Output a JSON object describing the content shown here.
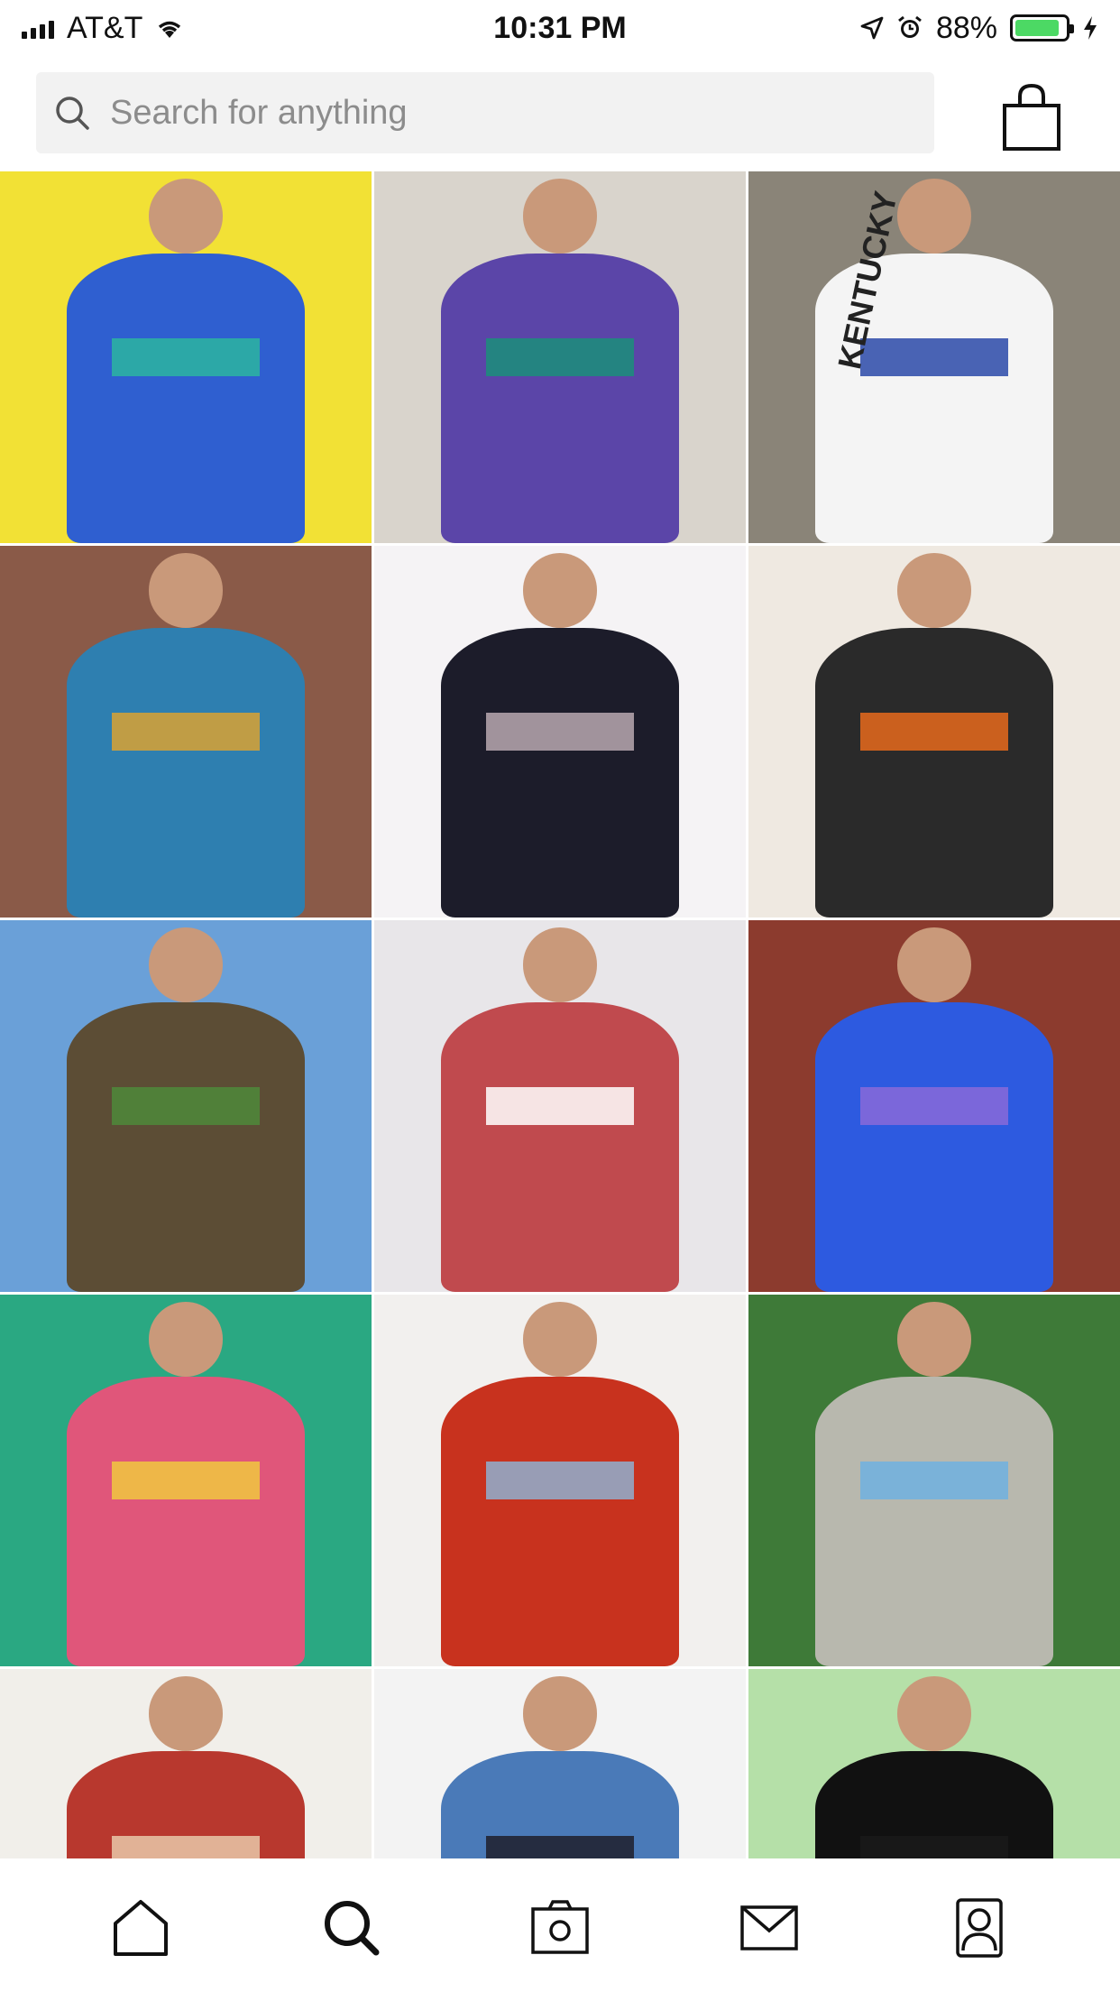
{
  "status_bar": {
    "carrier": "AT&T",
    "time": "10:31 PM",
    "battery": "88%",
    "battery_level": 0.88
  },
  "search": {
    "placeholder": "Search for anything",
    "icon": "search-icon"
  },
  "header": {
    "cart_icon": "shopping-bag-icon"
  },
  "products": [
    {
      "name": "product-blue-windbreaker",
      "colors": {
        "bg": "#f2e135",
        "item": "#2f5fd0",
        "accent": "#2bb5a0"
      }
    },
    {
      "name": "product-purple-teal-jacket",
      "colors": {
        "bg": "#d9d4cc",
        "item": "#5b45a8",
        "accent": "#1b8f7a"
      }
    },
    {
      "name": "product-kentucky-mickey-sweatshirt",
      "colors": {
        "bg": "#8a8478",
        "item": "#f4f4f4",
        "accent": "#2a49a8"
      },
      "text": "KENTUCKY"
    },
    {
      "name": "product-patterned-windbreaker",
      "colors": {
        "bg": "#8a5a48",
        "item": "#2e7fb0",
        "accent": "#d9a233"
      }
    },
    {
      "name": "product-leather-bucket-bag",
      "colors": {
        "bg": "#f5f3f5",
        "item": "#1c1c2a",
        "accent": "#b9a8b0"
      }
    },
    {
      "name": "product-patterned-knit-sweater",
      "colors": {
        "bg": "#efe9e1",
        "item": "#2a2a2a",
        "accent": "#e86a1c"
      }
    },
    {
      "name": "product-snakeskin-jacket",
      "colors": {
        "bg": "#6aa0d8",
        "item": "#5c4d35",
        "accent": "#4d8a3a"
      }
    },
    {
      "name": "product-striped-red-shirt",
      "colors": {
        "bg": "#e8e6e9",
        "item": "#c04a4e",
        "accent": "#ffffff"
      }
    },
    {
      "name": "product-blue-purple-tee",
      "colors": {
        "bg": "#8c3b2e",
        "item": "#2d5ae0",
        "accent": "#8a6ad8"
      }
    },
    {
      "name": "product-rainbow-organza-shawl",
      "colors": {
        "bg": "#2aa882",
        "item": "#e0567a",
        "accent": "#f0c840"
      }
    },
    {
      "name": "product-red-snakeskin-wrap-top",
      "colors": {
        "bg": "#f2f0ee",
        "item": "#c8321e",
        "accent": "#8fb0d0"
      }
    },
    {
      "name": "product-snakeskin-pants",
      "colors": {
        "bg": "#3e7a38",
        "item": "#b8b8ae",
        "accent": "#6fb0e0"
      }
    },
    {
      "name": "product-red-floral-peasant-top",
      "colors": {
        "bg": "#f1efea",
        "item": "#b8382e",
        "accent": "#e8c8a8"
      }
    },
    {
      "name": "product-blue-silk-blouse",
      "colors": {
        "bg": "#f3f3f3",
        "item": "#4a7ab8",
        "accent": "#1f1f2a"
      }
    },
    {
      "name": "product-black-graphic-tee",
      "colors": {
        "bg": "#b5e0a8",
        "item": "#111111",
        "accent": "#1a1a1a"
      }
    }
  ],
  "bottom_nav": [
    {
      "name": "nav-home",
      "icon": "home-icon"
    },
    {
      "name": "nav-search",
      "icon": "search-icon"
    },
    {
      "name": "nav-camera",
      "icon": "camera-icon"
    },
    {
      "name": "nav-messages",
      "icon": "mail-icon"
    },
    {
      "name": "nav-profile",
      "icon": "profile-icon"
    }
  ]
}
